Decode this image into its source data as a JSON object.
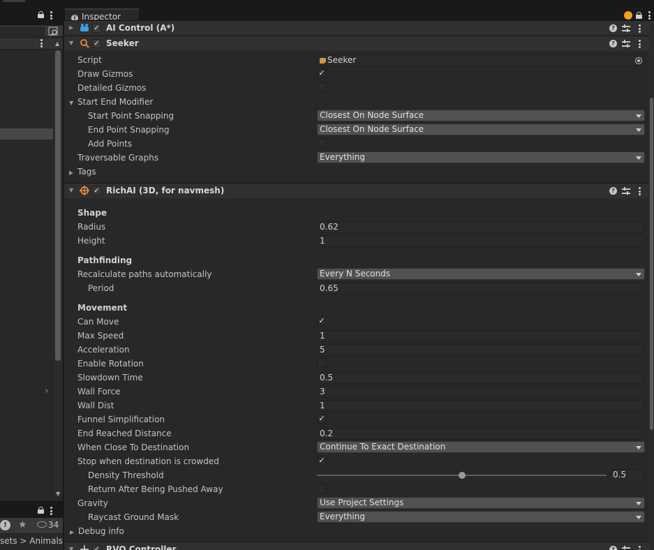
{
  "left_panel": {
    "view_count": "34",
    "breadcrumb": "sets > AnimalsR"
  },
  "inspector": {
    "tab_title": "Inspector",
    "components": {
      "ai_control": {
        "title": "AI Control (A*)"
      },
      "seeker": {
        "title": "Seeker",
        "script_label": "Script",
        "script_value": "Seeker",
        "draw_gizmos_label": "Draw Gizmos",
        "detailed_gizmos_label": "Detailed Gizmos",
        "start_end_modifier_label": "Start End Modifier",
        "start_point_snapping_label": "Start Point Snapping",
        "start_point_snapping_value": "Closest On Node Surface",
        "end_point_snapping_label": "End Point Snapping",
        "end_point_snapping_value": "Closest On Node Surface",
        "add_points_label": "Add Points",
        "traversable_graphs_label": "Traversable Graphs",
        "traversable_graphs_value": "Everything",
        "tags_label": "Tags"
      },
      "richai": {
        "title": "RichAI (3D, for navmesh)",
        "shape_header": "Shape",
        "radius_label": "Radius",
        "radius_value": "0.62",
        "height_label": "Height",
        "height_value": "1",
        "pathfinding_header": "Pathfinding",
        "recalc_label": "Recalculate paths automatically",
        "recalc_value": "Every N Seconds",
        "period_label": "Period",
        "period_value": "0.65",
        "movement_header": "Movement",
        "can_move_label": "Can Move",
        "max_speed_label": "Max Speed",
        "max_speed_value": "1",
        "acceleration_label": "Acceleration",
        "acceleration_value": "5",
        "enable_rotation_label": "Enable Rotation",
        "slowdown_time_label": "Slowdown Time",
        "slowdown_time_value": "0.5",
        "wall_force_label": "Wall Force",
        "wall_force_value": "3",
        "wall_dist_label": "Wall Dist",
        "wall_dist_value": "1",
        "funnel_label": "Funnel Simplification",
        "end_reached_label": "End Reached Distance",
        "end_reached_value": "0.2",
        "when_close_label": "When Close To Destination",
        "when_close_value": "Continue To Exact Destination",
        "stop_crowded_label": "Stop when destination is crowded",
        "density_label": "Density Threshold",
        "density_value": "0.5",
        "density_fraction": 0.5,
        "return_after_label": "Return After Being Pushed Away",
        "gravity_label": "Gravity",
        "gravity_value": "Use Project Settings",
        "raycast_label": "Raycast Ground Mask",
        "raycast_value": "Everything",
        "debug_label": "Debug info"
      },
      "rvo": {
        "title": "RVO Controller"
      }
    },
    "checkmark_glyph": "✓",
    "checkboxes": {
      "ai_control_enabled": true,
      "seeker_enabled": true,
      "richai_enabled": true,
      "rvo_enabled": true,
      "draw_gizmos": true,
      "detailed_gizmos": false,
      "add_points": false,
      "can_move": true,
      "enable_rotation": false,
      "funnel_simplification": true,
      "stop_when_crowded": true,
      "return_after_pushed": false
    }
  },
  "colors": {
    "panel_bg": "#282828",
    "header_bg": "#303030",
    "field_bg": "#2a2a2a",
    "dropdown_bg": "#515151",
    "accent_orange": "#f0a020",
    "text": "#c4c4c4"
  }
}
